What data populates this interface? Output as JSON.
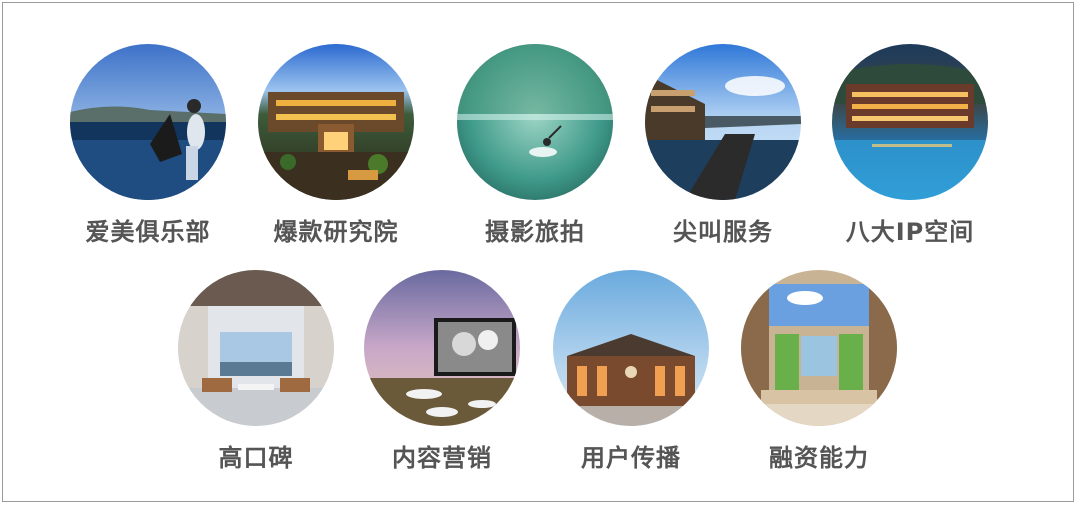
{
  "tiles": [
    {
      "label": "爱美俱乐部",
      "photo": "woman-sitting-by-lake-photo"
    },
    {
      "label": "爆款研究院",
      "photo": "hotel-courtyard-night-photo"
    },
    {
      "label": "摄影旅拍",
      "photo": "swimmer-green-water-photo"
    },
    {
      "label": "尖叫服务",
      "photo": "waterfront-resort-photo"
    },
    {
      "label": "八大IP空间",
      "photo": "lakeside-town-night-photo"
    },
    {
      "label": "高口碑",
      "photo": "lounge-interior-photo"
    },
    {
      "label": "内容营销",
      "photo": "outdoor-cinema-photo"
    },
    {
      "label": "用户传播",
      "photo": "lodge-building-dusk-photo"
    },
    {
      "label": "融资能力",
      "photo": "greenhouse-room-photo"
    }
  ],
  "colors": {
    "caption": "#555555",
    "border": "#9a9a9a",
    "background": "#ffffff"
  }
}
